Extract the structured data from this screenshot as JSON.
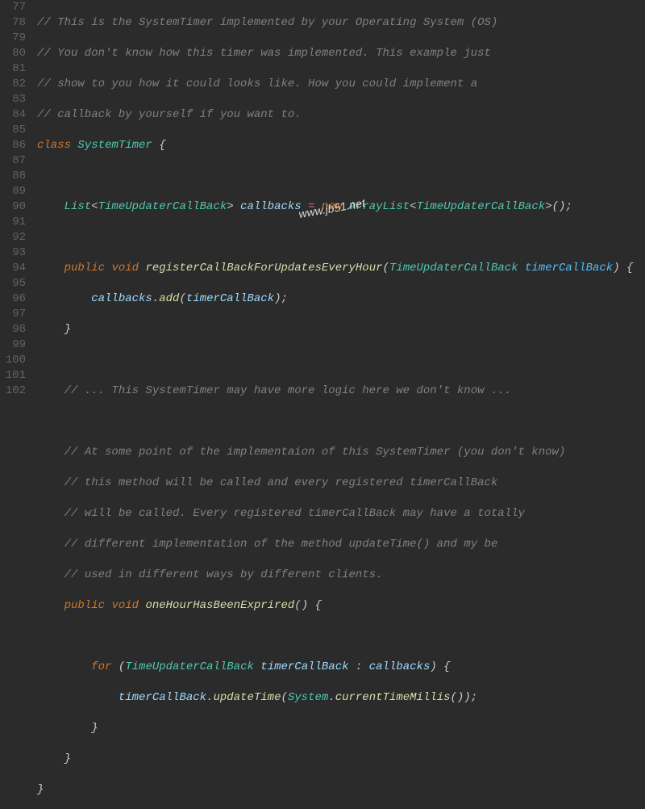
{
  "watermark": "www.jb51.net",
  "gutter": [
    "77",
    "78",
    "79",
    "80",
    "81",
    "82",
    "83",
    "84",
    "85",
    "86",
    "87",
    "88",
    "89",
    "90",
    "91",
    "92",
    "93",
    "94",
    "95",
    "96",
    "97",
    "98",
    "99",
    "100",
    "101",
    "102"
  ],
  "code": {
    "l77_c": "// This is the SystemTimer implemented by your Operating System (OS)",
    "l78_c": "// You don't know how this timer was implemented. This example just",
    "l79_c": "// show to you how it could looks like. How you could implement a",
    "l80_c": "// callback by yourself if you want to.",
    "l81_kw_class": "class",
    "l81_type": "SystemTimer",
    "l81_brace": " {",
    "l83_type_list": "List",
    "l83_gen1": "TimeUpdaterCallBack",
    "l83_var": "callbacks",
    "l83_eq": " = ",
    "l83_new": "new",
    "l83_arr": "ArrayList",
    "l83_gen2": "TimeUpdaterCallBack",
    "l83_tail": "();",
    "l85_pub": "public",
    "l85_void": "void",
    "l85_m": "registerCallBackForUpdatesEveryHour",
    "l85_p_t": "TimeUpdaterCallBack",
    "l85_p_n": "timerCallBack",
    "l85_close": ") {",
    "l86_var": "callbacks",
    "l86_dot": ".",
    "l86_add": "add",
    "l86_arg": "timerCallBack",
    "l86_end": ");",
    "l87_brace": "}",
    "l89_c": "// ... This SystemTimer may have more logic here we don't know ...",
    "l91_c": "// At some point of the implementaion of this SystemTimer (you don't know)",
    "l92_c": "// this method will be called and every registered timerCallBack",
    "l93_c": "// will be called. Every registered timerCallBack may have a totally",
    "l94_c": "// different implementation of the method updateTime() and my be",
    "l95_c": "// used in different ways by different clients.",
    "l96_pub": "public",
    "l96_void": "void",
    "l96_m": "oneHourHasBeenExprired",
    "l96_close": "() {",
    "l98_for": "for",
    "l98_t": "TimeUpdaterCallBack",
    "l98_n": "timerCallBack",
    "l98_colon": " : ",
    "l98_cb": "callbacks",
    "l98_end": ") {",
    "l99_obj": "timerCallBack",
    "l99_m": "updateTime",
    "l99_sys": "System",
    "l99_ctm": "currentTimeMillis",
    "l99_end": "());",
    "l100_brace": "}",
    "l101_brace": "}",
    "l102_brace": "}"
  },
  "chart_data": null
}
